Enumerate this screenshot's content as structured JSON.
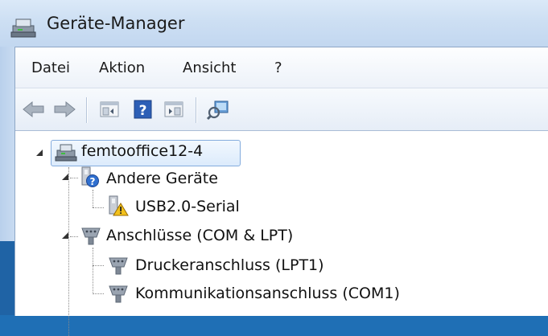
{
  "window": {
    "title": "Geräte-Manager"
  },
  "menu": {
    "items": [
      "Datei",
      "Aktion",
      "Ansicht",
      "?"
    ]
  },
  "toolbar": {
    "buttons": [
      "back-icon",
      "forward-icon",
      "show-hide-console-tree-icon",
      "help-icon",
      "action-pane-icon",
      "scan-hardware-icon"
    ]
  },
  "tree": {
    "root": "femtooffice12-4",
    "nodes": [
      {
        "label": "Andere Geräte",
        "children": [
          "USB2.0-Serial"
        ]
      },
      {
        "label": "Anschlüsse (COM & LPT)",
        "children": [
          "Druckeranschluss (LPT1)",
          "Kommunikationsanschluss (COM1)"
        ]
      }
    ]
  },
  "colors": {
    "selection": "#dcebfc",
    "selection_border": "#84acdd",
    "accent": "#1f6fb5"
  }
}
